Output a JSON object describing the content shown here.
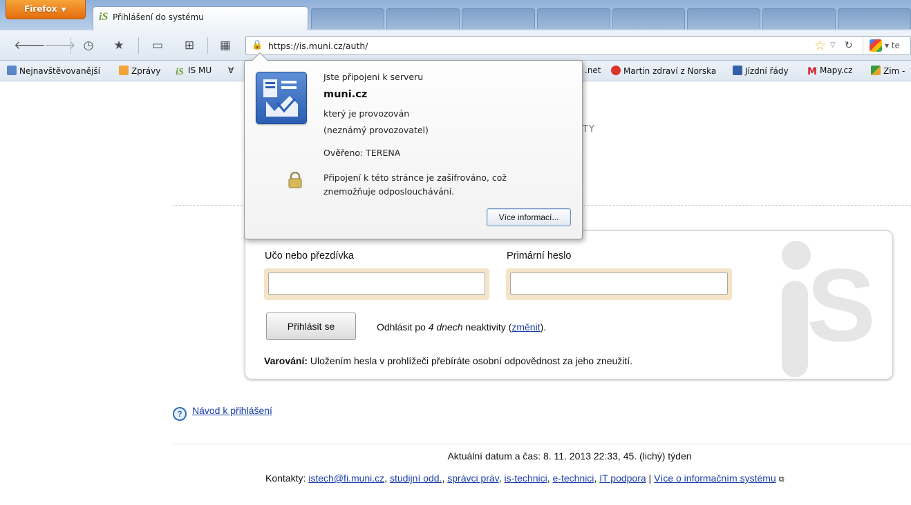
{
  "browser": {
    "menu_button": "Firefox",
    "active_tab_title": "Přihlášení do systému",
    "url": "https://is.muni.cz/auth/",
    "search_engine_text": "te"
  },
  "bookmarks": [
    {
      "label": "Nejnavštěvovanější",
      "icon": "globe-icon"
    },
    {
      "label": "Zprávy",
      "icon": "rss-icon"
    },
    {
      "label": "IS MU",
      "icon": "is-logo-icon"
    },
    {
      "label": ".net",
      "icon": "bookmark-icon"
    },
    {
      "label": "Martin zdraví z Norska",
      "icon": "apple-icon"
    },
    {
      "label": "Jízdní řády",
      "icon": "timetable-icon"
    },
    {
      "label": "Mapy.cz",
      "icon": "m-logo-icon"
    },
    {
      "label": "Zim -",
      "icon": "bookmark-icon"
    }
  ],
  "identity_popup": {
    "connected_to": "Jste připojeni k serveru",
    "host": "muni.cz",
    "operated_by": "který je provozován",
    "owner": "(neznámý provozovatel)",
    "verified": "Ověřeno: TERENA",
    "encryption_line1": "Připojení k této stránce je zašifrováno, což",
    "encryption_line2": "znemožňuje odposlouchávání.",
    "more_info_button": "Více informací..."
  },
  "page": {
    "header_fragment": "TY",
    "login": {
      "username_label": "Učo nebo přezdívka",
      "username_value": "",
      "password_label": "Primární heslo",
      "password_value": "",
      "submit_label": "Přihlásit se",
      "logout_prefix": "Odhlásit po ",
      "logout_period": "4 dnech",
      "logout_middle": " neaktivity (",
      "logout_change_link": "změnit",
      "logout_suffix": ").",
      "warning_bold": "Varování:",
      "warning_text": " Uložením hesla v prohlížeči přebíráte osobní odpovědnost za jeho zneužití."
    },
    "help_link": "Návod k přihlášení",
    "datetime": "Aktuální datum a čas: 8. 11. 2013 22:33, 45. (lichý) týden",
    "contacts": {
      "prefix": "Kontakty: ",
      "links": [
        "istech@fi.muni.cz",
        "studijní odd.",
        "správci práv",
        "is-technici",
        "e-technici",
        "IT podpora"
      ],
      "separator": " | ",
      "last_link": "Více o informačním systému"
    }
  },
  "colors": {
    "accent_orange": "#e46d0c",
    "link_blue": "#1a3fa8",
    "field_highlight": "#f6e4c9"
  }
}
